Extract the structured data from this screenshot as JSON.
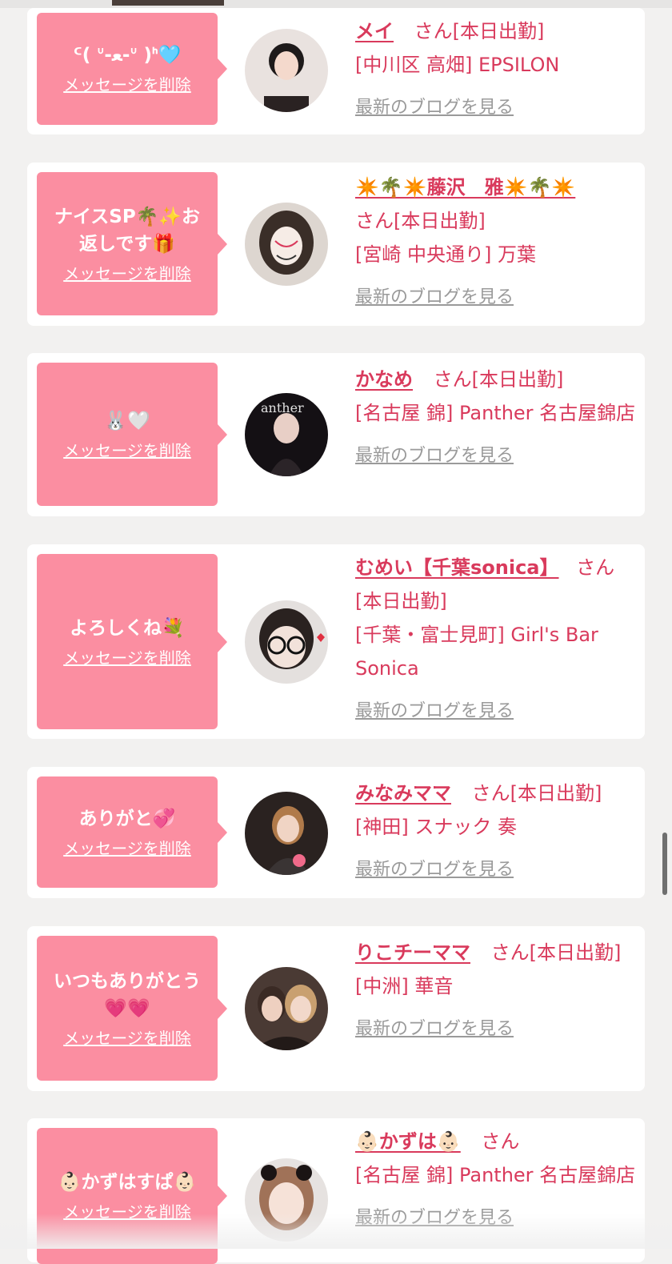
{
  "colors": {
    "accent": "#d93a5c",
    "bubble": "#fb8ea1",
    "link_gray": "#9a9a9a",
    "background": "#f2f1f0"
  },
  "cards": [
    {
      "message": "ᑦ( ᐡ-ﻌ-ᐡ )ᑋ🩵",
      "delete_label": "メッセージを削除",
      "name": "メイ",
      "honorific": "さん[本日出勤]",
      "shop": "[中川区 高畑] EPSILON",
      "blog_label": "最新のブログを見る"
    },
    {
      "message": "ナイスSP🌴✨お返しです🎁",
      "delete_label": "メッセージを削除",
      "name": "✴️🌴✴️藤沢　雅✴️🌴✴️",
      "honorific": "さん[本日出勤]",
      "shop": "[宮崎 中央通り] 万葉",
      "blog_label": "最新のブログを見る"
    },
    {
      "message": "🐰🤍",
      "delete_label": "メッセージを削除",
      "name": "かなめ",
      "honorific": "さん[本日出勤]",
      "shop": "[名古屋 錦] Panther 名古屋錦店",
      "blog_label": "最新のブログを見る"
    },
    {
      "message": "よろしくね︎💐",
      "delete_label": "メッセージを削除",
      "name": "むめい【千葉sonica】",
      "honorific": "さん[本日出勤]",
      "shop": "[千葉・富士見町] Girl's Bar Sonica",
      "blog_label": "最新のブログを見る"
    },
    {
      "message": "ありがと💞",
      "delete_label": "メッセージを削除",
      "name": "みなみママ",
      "honorific": "さん[本日出勤]",
      "shop": "[神田] スナック 奏",
      "blog_label": "最新のブログを見る"
    },
    {
      "message": "いつもありがとう💗💗",
      "delete_label": "メッセージを削除",
      "name": "りこチーママ",
      "honorific": "さん[本日出勤]",
      "shop": "[中洲] 華音",
      "blog_label": "最新のブログを見る"
    },
    {
      "message": "👶🏻かずはすぱ👶🏻",
      "delete_label": "メッセージを削除",
      "name": "👶🏻かずは👶🏻",
      "honorific": "さん",
      "shop": "[名古屋 錦] Panther 名古屋錦店",
      "blog_label": "最新のブログを見る"
    }
  ]
}
